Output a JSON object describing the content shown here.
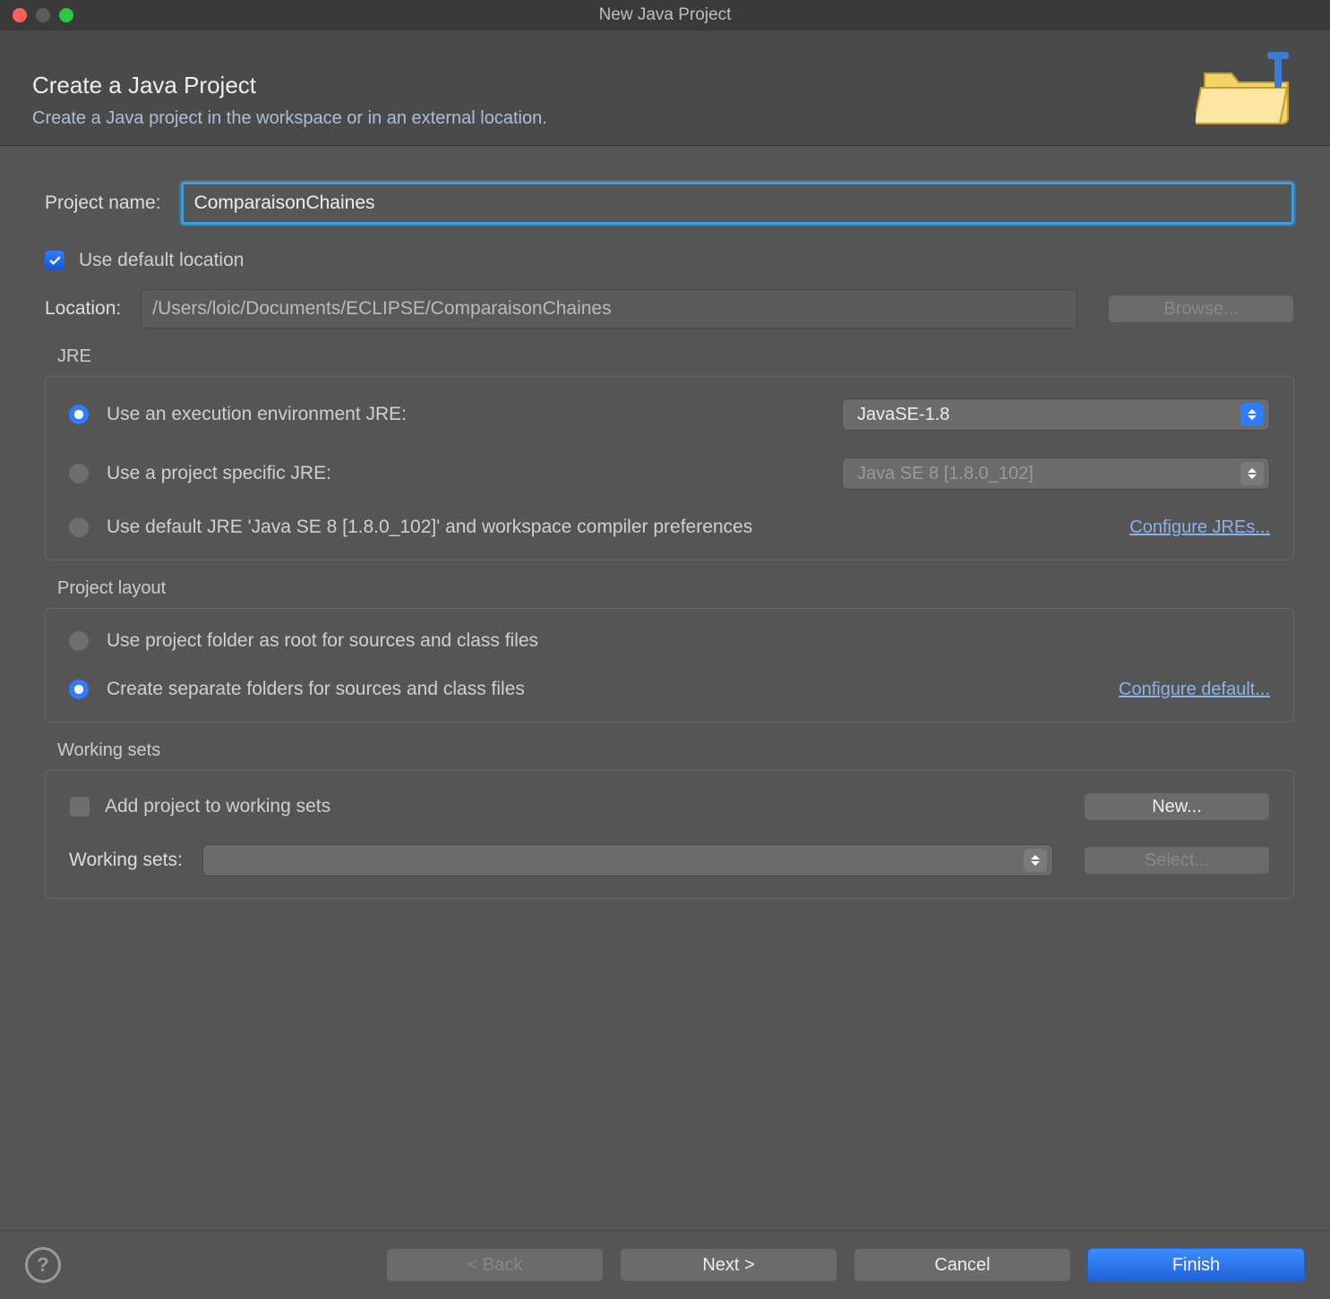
{
  "window": {
    "title": "New Java Project"
  },
  "header": {
    "title": "Create a Java Project",
    "subtitle": "Create a Java project in the workspace or in an external location."
  },
  "form": {
    "project_name_label": "Project name:",
    "project_name_value": "ComparaisonChaines",
    "default_location_label": "Use default location",
    "location_label": "Location:",
    "location_value": "/Users/loic/Documents/ECLIPSE/ComparaisonChaines",
    "browse_label": "Browse..."
  },
  "jre": {
    "group_label": "JRE",
    "exec_env_label": "Use an execution environment JRE:",
    "exec_env_value": "JavaSE-1.8",
    "project_jre_label": "Use a project specific JRE:",
    "project_jre_value": "Java SE 8 [1.8.0_102]",
    "default_jre_label": "Use default JRE 'Java SE 8 [1.8.0_102]' and workspace compiler preferences",
    "configure_link": "Configure JREs..."
  },
  "layout": {
    "group_label": "Project layout",
    "opt1": "Use project folder as root for sources and class files",
    "opt2": "Create separate folders for sources and class files",
    "configure_link": "Configure default..."
  },
  "working_sets": {
    "group_label": "Working sets",
    "add_label": "Add project to working sets",
    "new_label": "New...",
    "ws_label": "Working sets:",
    "select_label": "Select..."
  },
  "footer": {
    "back": "< Back",
    "next": "Next >",
    "cancel": "Cancel",
    "finish": "Finish"
  }
}
